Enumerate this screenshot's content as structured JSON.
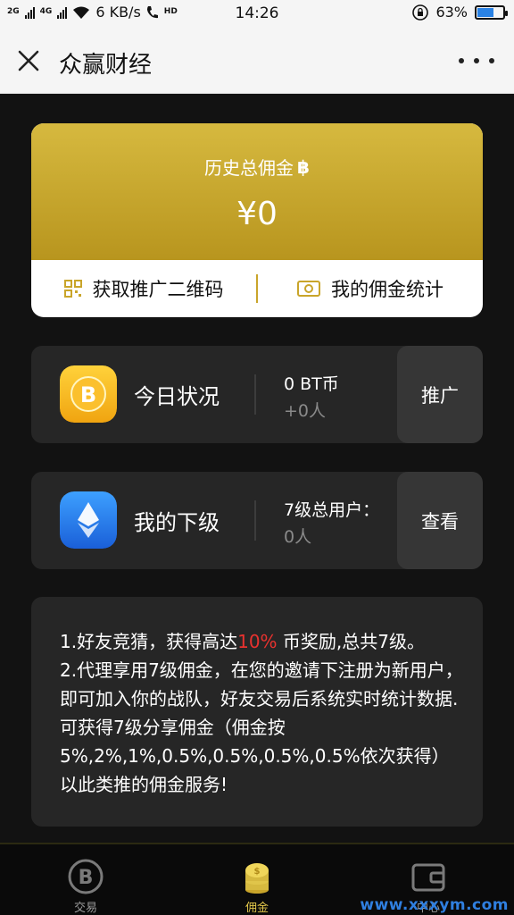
{
  "status_bar": {
    "signal_labels": [
      "2G",
      "4G"
    ],
    "network_speed": "6 KB/s",
    "hd_label": "HD",
    "time": "14:26",
    "battery_percent": "63%",
    "battery_level": 0.63
  },
  "header": {
    "title": "众赢财经",
    "icons": [
      "close-icon",
      "more-icon"
    ]
  },
  "commission": {
    "label": "历史总佣金",
    "symbol": "฿",
    "amount": "¥0",
    "qr_label": "获取推广二维码",
    "stats_label": "我的佣金统计"
  },
  "today": {
    "label": "今日状况",
    "line1": "0 BT币",
    "line2": "+0人",
    "button": "推广",
    "icon": "bitcoin-icon"
  },
  "downline": {
    "label": "我的下级",
    "line1": "7级总用户：",
    "line2": "0人",
    "button": "查看",
    "icon": "ethereum-icon"
  },
  "description": {
    "p1_before": "1.好友竞猜，获得高达",
    "p1_highlight": "10%",
    "p1_after": " 币奖励,总共7级。",
    "p2": "2.代理享用7级佣金，在您的邀请下注册为新用户，即可加入你的战队，好友交易后系统实时统计数据.可获得7级分享佣金（佣金按5%,2%,1%,0.5%,0.5%,0.5%,0.5%依次获得）以此类推的佣金服务!",
    "highlight_color": "#e8322f"
  },
  "tabs": [
    {
      "label": "交易",
      "icon": "bitcoin-tab-icon"
    },
    {
      "label": "佣金",
      "icon": "coins-icon",
      "active": true
    },
    {
      "label": "中心",
      "icon": "wallet-icon"
    }
  ],
  "watermark": "www.xxxym.com",
  "colors": {
    "gold": "#d6b93f",
    "accent_tab": "#e0c54a",
    "background": "#121212"
  }
}
